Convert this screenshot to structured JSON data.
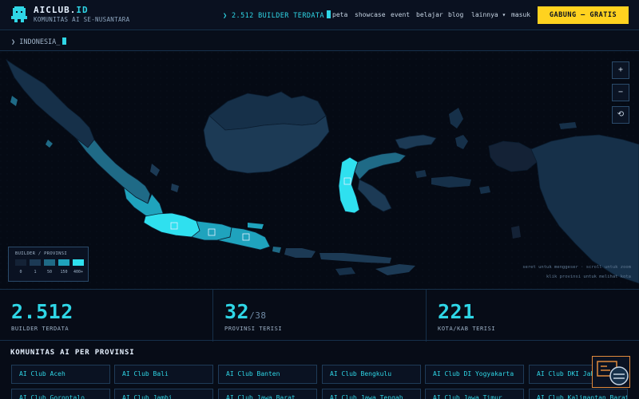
{
  "brand": {
    "name_main": "AICLUB.",
    "name_tld": "ID",
    "tagline": "KOMUNITAS AI SE-NUSANTARA",
    "logo_icon": "pixel-robot-icon",
    "accent_color": "#2fd6e6"
  },
  "ticker": {
    "text": "❯ 2.512 BUILDER TERDATA"
  },
  "nav": {
    "items": [
      "peta",
      "showcase",
      "event",
      "belajar",
      "blog",
      "lainnya ▾",
      "masuk"
    ]
  },
  "cta": {
    "label": "GABUNG — GRATIS",
    "color": "#ffd21f"
  },
  "breadcrumb": {
    "text": "❯ INDONESIA_"
  },
  "map": {
    "zoom_in": "+",
    "zoom_out": "−",
    "reset": "⟲",
    "hint_drag": "seret untuk menggeser · scroll untuk zoom",
    "hint_click": "klik provinsi untuk melihat kota",
    "legend": {
      "title": "BUILDER / PROVINSI",
      "bins": [
        {
          "label": "0",
          "color": "#142236"
        },
        {
          "label": "1",
          "color": "#1c3a55"
        },
        {
          "label": "50",
          "color": "#1f6a86"
        },
        {
          "label": "150",
          "color": "#1fa3bd"
        },
        {
          "label": "400+",
          "color": "#2fe0ef"
        }
      ]
    }
  },
  "stats": [
    {
      "value": "2.512",
      "suffix": "",
      "label": "BUILDER TERDATA"
    },
    {
      "value": "32",
      "suffix": "/38",
      "label": "PROVINSI TERISI"
    },
    {
      "value": "221",
      "suffix": "",
      "label": "KOTA/KAB TERISI"
    }
  ],
  "provinces": {
    "title": "KOMUNITAS AI PER PROVINSI",
    "items": [
      "AI Club Aceh",
      "AI Club Bali",
      "AI Club Banten",
      "AI Club Bengkulu",
      "AI Club DI Yogyakarta",
      "AI Club DKI Jakarta",
      "AI Club Gorontalo",
      "AI Club Jambi",
      "AI Club Jawa Barat",
      "AI Club Jawa Tengah",
      "AI Club Jawa Timur",
      "AI Club Kalimantan Barat"
    ]
  },
  "fab": {
    "icon": "chat-robot-icon"
  }
}
